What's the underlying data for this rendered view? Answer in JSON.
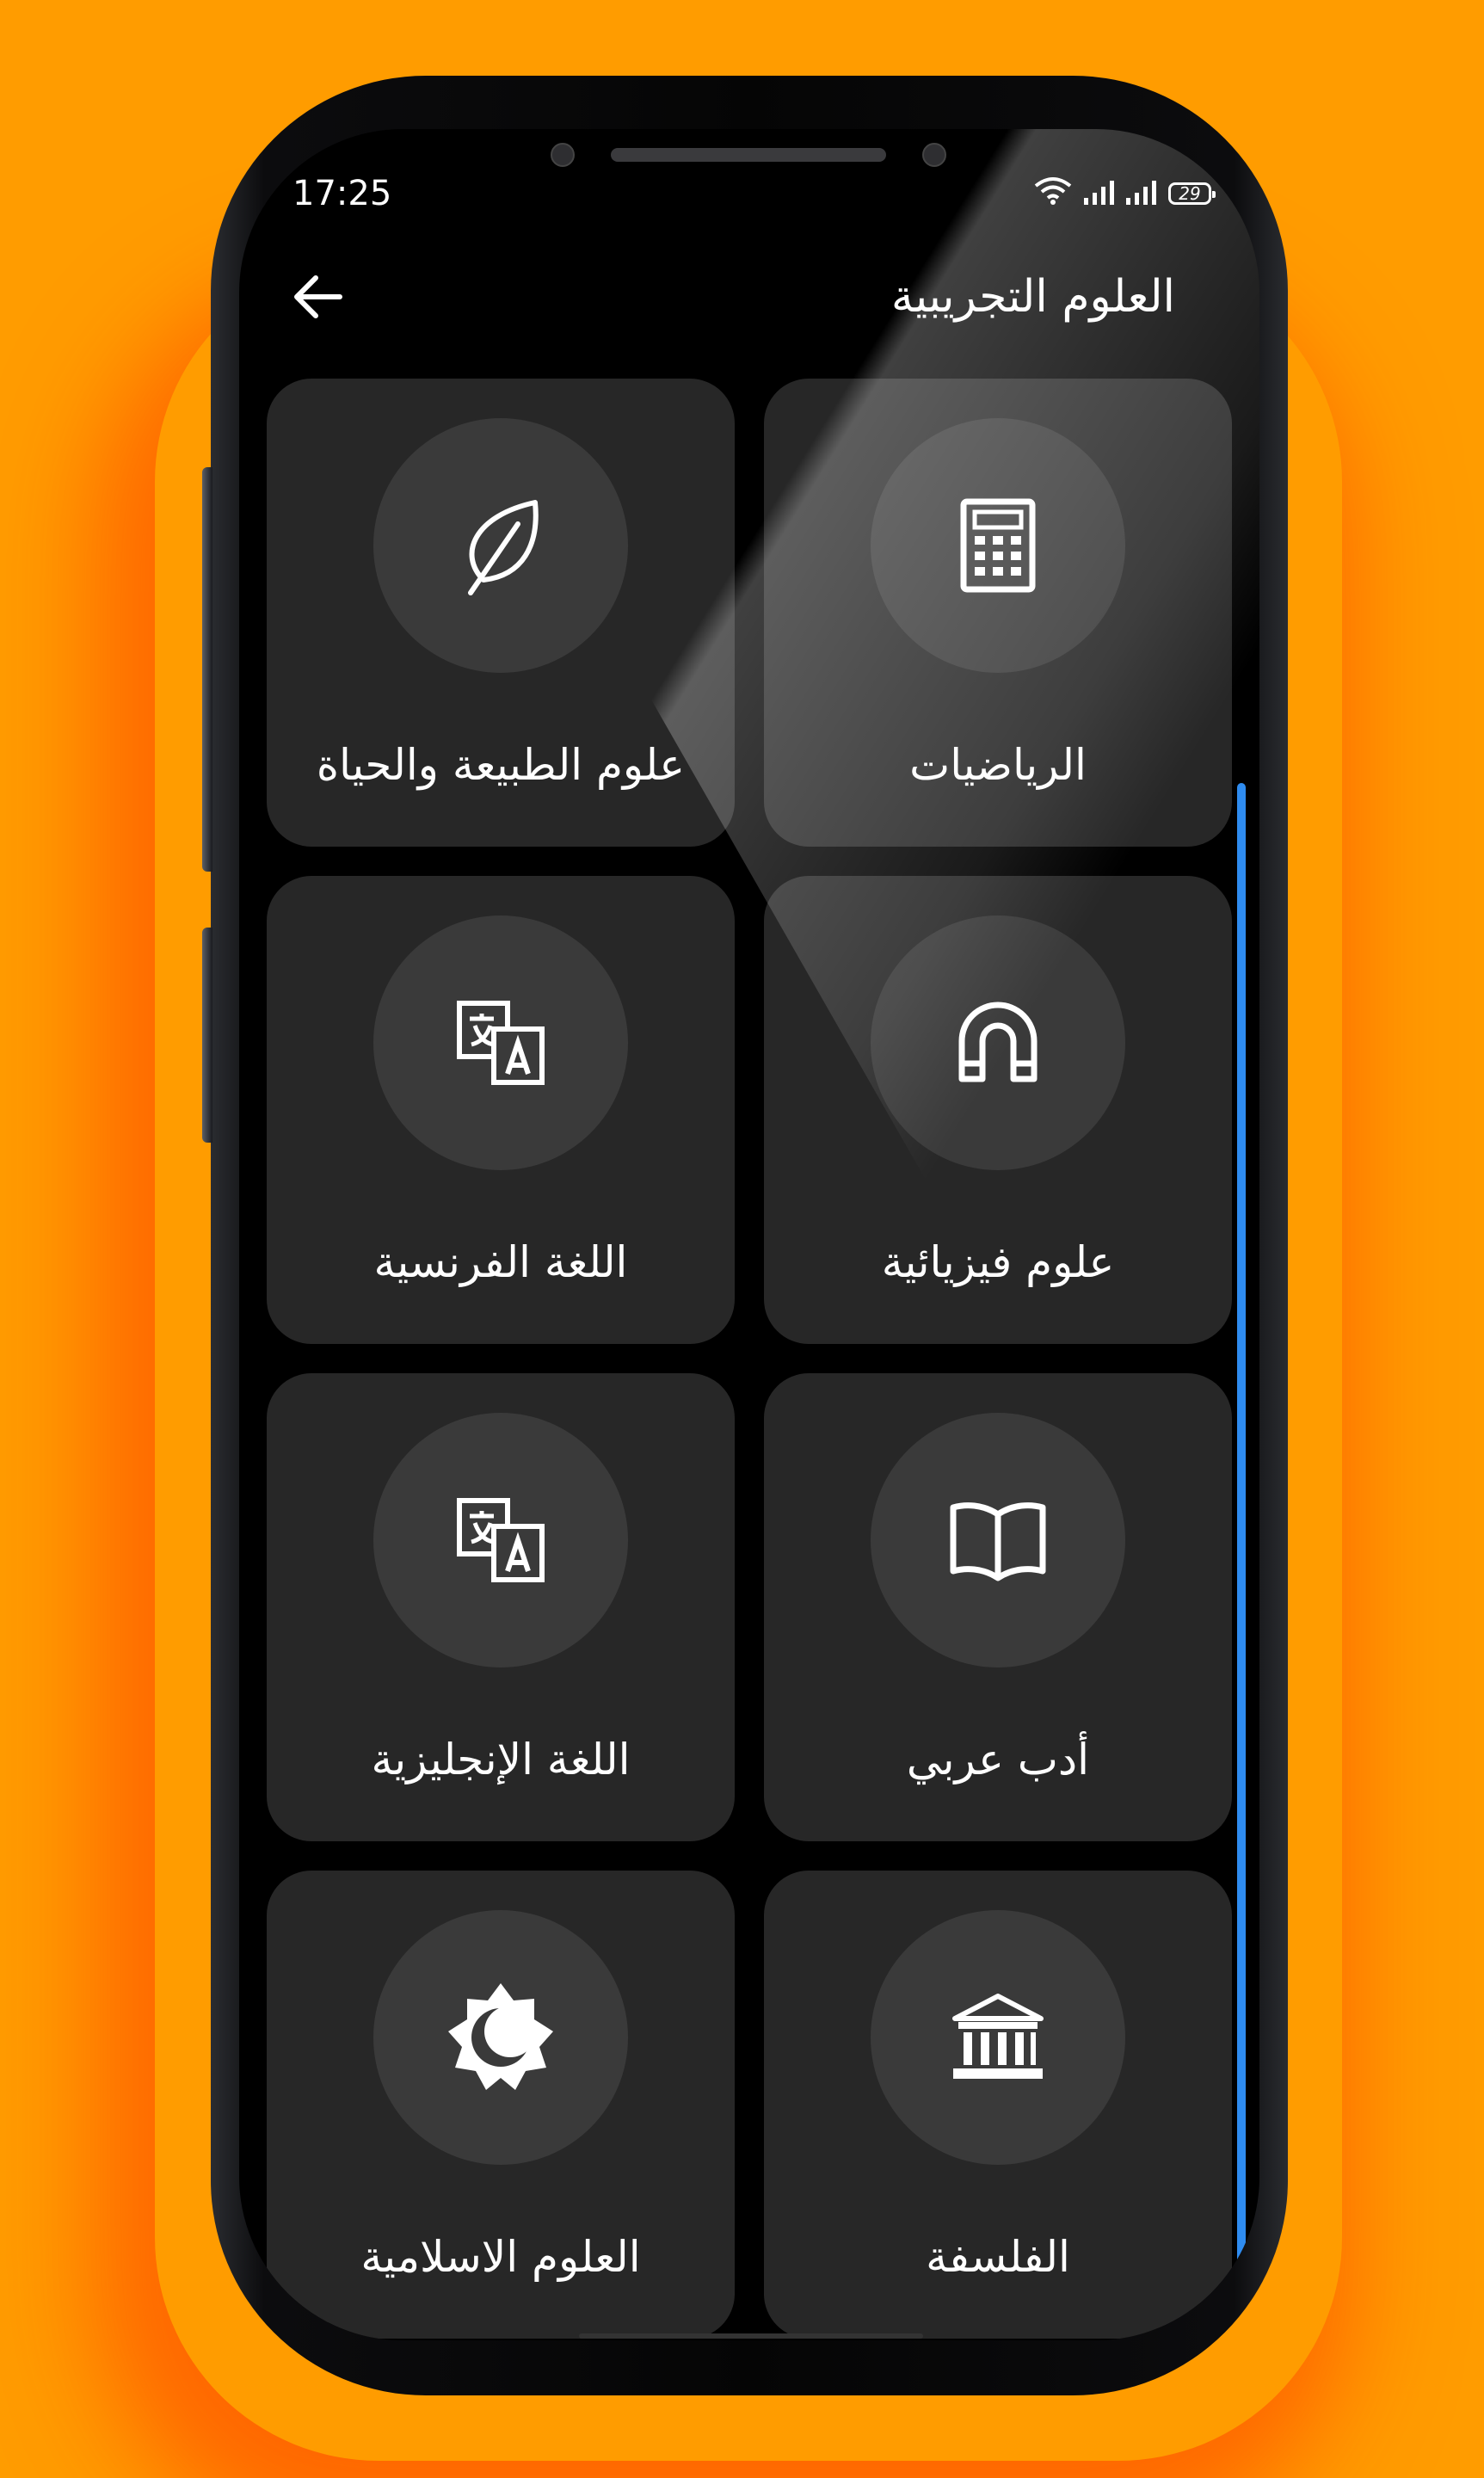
{
  "status_bar": {
    "time": "17:25",
    "battery": "29"
  },
  "header": {
    "title": "العلوم التجريبية",
    "back_icon": "arrow-left-icon"
  },
  "subjects": [
    {
      "label": "الرياضيات",
      "icon": "calculator-icon"
    },
    {
      "label": "علوم الطبيعة والحياة",
      "icon": "leaf-icon"
    },
    {
      "label": "علوم فيزيائية",
      "icon": "magnet-icon"
    },
    {
      "label": "اللغة الفرنسية",
      "icon": "translate-icon"
    },
    {
      "label": "أدب عربي",
      "icon": "book-open-icon"
    },
    {
      "label": "اللغة الإنجليزية",
      "icon": "translate-icon"
    },
    {
      "label": "الفلسفة",
      "icon": "museum-icon"
    },
    {
      "label": "العلوم الاسلامية",
      "icon": "sun-moon-icon"
    }
  ],
  "colors": {
    "background": "#FF9C00",
    "screen": "#000000",
    "card": "#272727",
    "icon_circle": "#3a3a3a",
    "scrollbar": "#2f8cf0"
  }
}
